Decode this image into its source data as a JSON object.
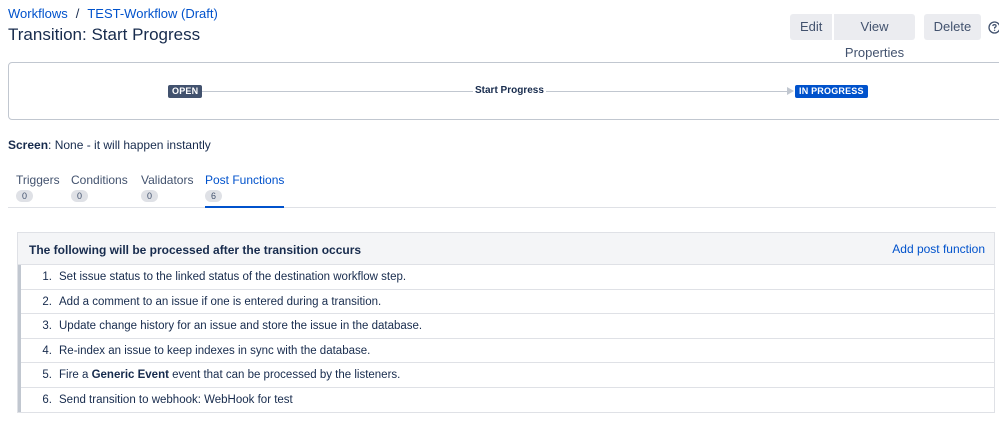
{
  "breadcrumbs": {
    "items": [
      "Workflows",
      "TEST-Workflow (Draft)"
    ],
    "separator": "/"
  },
  "page": {
    "title": "Transition: Start Progress"
  },
  "actions": {
    "edit": "Edit",
    "view_properties": "View Properties",
    "delete": "Delete",
    "help_icon": "help-icon"
  },
  "diagram": {
    "from_status": "OPEN",
    "transition_name": "Start Progress",
    "to_status": "IN PROGRESS",
    "colors": {
      "open": "#42526e",
      "in_progress": "#0052cc"
    }
  },
  "screen": {
    "label": "Screen",
    "value": ": None - it will happen instantly"
  },
  "tabs": [
    {
      "label": "Triggers",
      "count": "0"
    },
    {
      "label": "Conditions",
      "count": "0"
    },
    {
      "label": "Validators",
      "count": "0"
    },
    {
      "label": "Post Functions",
      "count": "6",
      "active": true
    }
  ],
  "post_functions": {
    "header": "The following will be processed after the transition occurs",
    "add_link": "Add post function",
    "items": [
      {
        "num": "1.",
        "text": "Set issue status to the linked status of the destination workflow step."
      },
      {
        "num": "2.",
        "text": "Add a comment to an issue if one is entered during a transition."
      },
      {
        "num": "3.",
        "text": "Update change history for an issue and store the issue in the database."
      },
      {
        "num": "4.",
        "text": "Re-index an issue to keep indexes in sync with the database."
      },
      {
        "num": "5.",
        "pre": "Fire a ",
        "bold": "Generic Event",
        "post": " event that can be processed by the listeners."
      },
      {
        "num": "6.",
        "text": "Send transition to webhook: WebHook for test"
      }
    ]
  },
  "accent_color": "#0052cc"
}
